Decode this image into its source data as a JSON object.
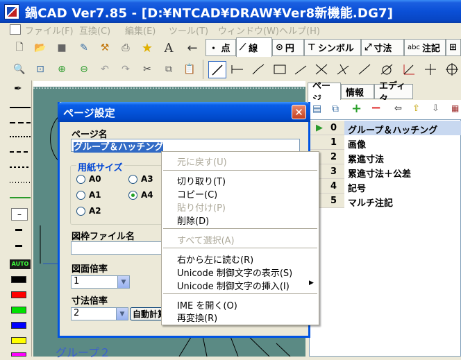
{
  "window": {
    "title": "鍋CAD Ver7.85 - [D:¥NTCAD¥DRAW¥Ver8新機能.DG7]"
  },
  "menu": [
    "ファイル(F)",
    "互換(C)",
    "編集(E)",
    "ツール(T)",
    "ウィンドウ(W)",
    "ヘルプ(H)"
  ],
  "mode_tabs": [
    "・ 点",
    "線",
    "円",
    "シンボル",
    "寸法",
    "注記"
  ],
  "right_tabs": [
    "ページ",
    "情報",
    "エディタ"
  ],
  "pages": [
    {
      "num": "0",
      "name": "グループ＆ハッチング"
    },
    {
      "num": "1",
      "name": "画像"
    },
    {
      "num": "2",
      "name": "累進寸法"
    },
    {
      "num": "3",
      "name": "累進寸法＋公差"
    },
    {
      "num": "4",
      "name": "記号"
    },
    {
      "num": "5",
      "name": "マルチ注記"
    }
  ],
  "palette": {
    "auto_label": "AUTO",
    "dash_label": "–"
  },
  "dialog": {
    "title": "ページ設定",
    "close": "✕",
    "page_name_label": "ページ名",
    "page_name_value": "グループ＆ハッチング",
    "paper_size_label": "用紙サイズ",
    "sizes": [
      "A0",
      "A3",
      "A1",
      "A4",
      "A2"
    ],
    "frame_file_label": "図枠ファイル名",
    "scale_label": "図面倍率",
    "scale_value": "1",
    "dim_scale_label": "寸法倍率",
    "dim_scale_value": "2",
    "auto_calc": "自動計算"
  },
  "context_menu": [
    {
      "label": "元に戻す(U)",
      "disabled": true
    },
    {
      "label": "切り取り(T)",
      "disabled": false
    },
    {
      "label": "コピー(C)",
      "disabled": false
    },
    {
      "label": "貼り付け(P)",
      "disabled": true
    },
    {
      "label": "削除(D)",
      "disabled": false
    },
    {
      "label": "すべて選択(A)",
      "disabled": true
    },
    {
      "label": "右から左に読む(R)",
      "disabled": false
    },
    {
      "label": "Unicode 制御文字の表示(S)",
      "disabled": false
    },
    {
      "label": "Unicode 制御文字の挿入(I)",
      "disabled": false
    },
    {
      "label": "IME を開く(O)",
      "disabled": false
    },
    {
      "label": "再変換(R)",
      "disabled": false
    }
  ],
  "canvas_label": "グループ２",
  "colors": {
    "title_blue": "#0a4fd6",
    "selection": "#316ac5",
    "canvas_green": "#5b8a84"
  }
}
